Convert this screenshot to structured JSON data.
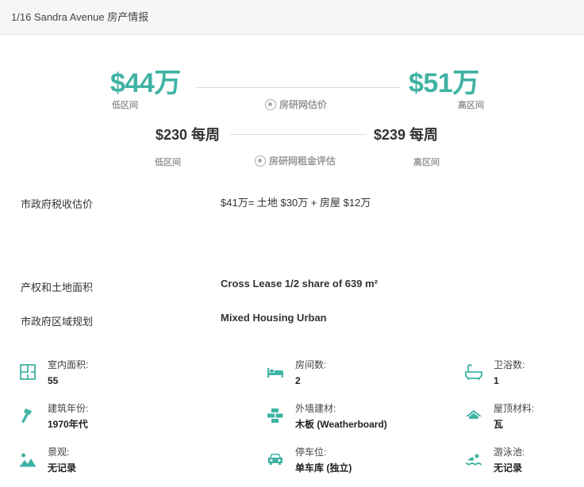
{
  "header": {
    "title": "1/16 Sandra Avenue 房产情报"
  },
  "sale_estimate": {
    "low_price": "$44万",
    "high_price": "$51万",
    "low_label": "低区间",
    "high_label": "高区间",
    "caption": "房研网估价"
  },
  "rent_estimate": {
    "low_price": "$230 每周",
    "high_price": "$239 每周",
    "low_label": "低区间",
    "high_label": "高区间",
    "caption": "房研网租金评估"
  },
  "rows": [
    {
      "label": "市政府税收估价",
      "value": "$41万= 土地 $30万 + 房屋 $12万"
    },
    {
      "label": "产权和土地面积",
      "value": "Cross Lease 1/2 share of 639 m²"
    },
    {
      "label": "市政府区域规划",
      "value": "Mixed Housing Urban"
    }
  ],
  "features": [
    {
      "icon": "floor-plan-icon",
      "label": "室内面积:",
      "value": "55"
    },
    {
      "icon": "bed-icon",
      "label": "房间数:",
      "value": "2"
    },
    {
      "icon": "bathtub-icon",
      "label": "卫浴数:",
      "value": "1"
    },
    {
      "icon": "hammer-icon",
      "label": "建筑年份:",
      "value": "1970年代"
    },
    {
      "icon": "brick-wall-icon",
      "label": "外墙建材:",
      "value": "木板 (Weatherboard)"
    },
    {
      "icon": "roof-icon",
      "label": "屋顶材料:",
      "value": "瓦"
    },
    {
      "icon": "landscape-icon",
      "label": "景观:",
      "value": "无记录"
    },
    {
      "icon": "car-icon",
      "label": "停车位:",
      "value": "单车库 (独立)"
    },
    {
      "icon": "swimmer-icon",
      "label": "游泳池:",
      "value": "无记录"
    }
  ],
  "colors": {
    "accent": "#3fb3a3",
    "icon": "#3fb3a3"
  }
}
